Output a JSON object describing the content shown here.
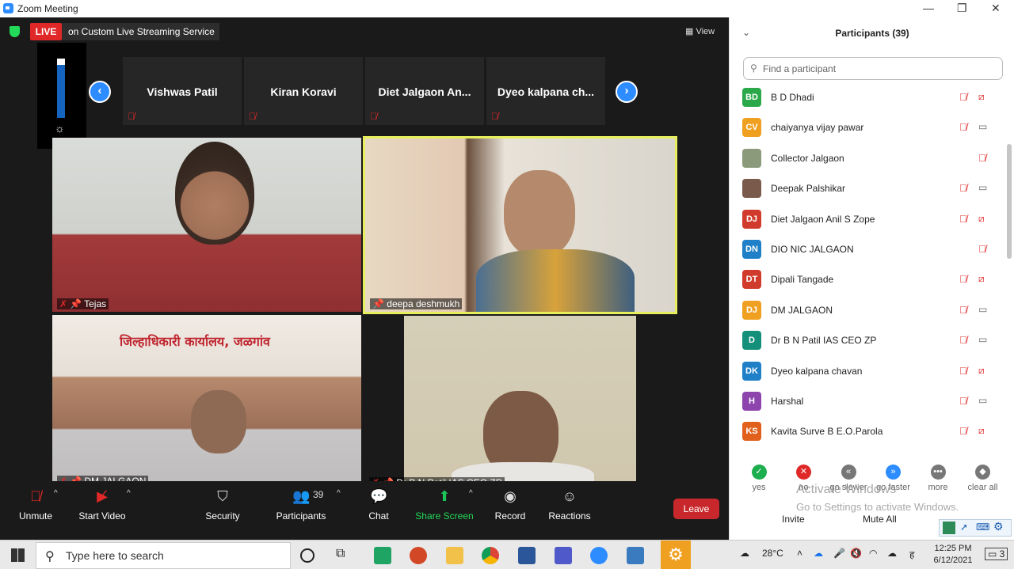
{
  "window": {
    "title": "Zoom Meeting"
  },
  "live": {
    "badge": "LIVE",
    "service": "on Custom Live Streaming Service",
    "dropdown": "▾"
  },
  "view": {
    "label": "View"
  },
  "strip": {
    "tiles": [
      "Vishwas Patil",
      "Kiran Koravi",
      "Diet Jalgaon An...",
      "Dyeo kalpana ch..."
    ]
  },
  "videos": [
    {
      "name": "Tejas"
    },
    {
      "name": "deepa deshmukh"
    },
    {
      "name": "DM JALGAON",
      "sign": "जिल्हाधिकारी कार्यालय, जळगांव"
    },
    {
      "name": "Dr B N Patil IAS CEO ZP"
    }
  ],
  "toolbar": {
    "unmute": "Unmute",
    "start_video": "Start Video",
    "security": "Security",
    "participants": "Participants",
    "participants_count": "39",
    "chat": "Chat",
    "share_screen": "Share Screen",
    "record": "Record",
    "reactions": "Reactions",
    "leave": "Leave"
  },
  "panel": {
    "title": "Participants (39)",
    "search_placeholder": "Find a participant",
    "participants": [
      {
        "initials": "BD",
        "name": "B D Dhadi",
        "color": "#2aa84a",
        "video": "off"
      },
      {
        "initials": "CV",
        "name": "chaiyanya vijay pawar",
        "color": "#f0a020",
        "video": "on"
      },
      {
        "initials": "",
        "name": "Collector Jalgaon",
        "color": "#8a9a7a",
        "video": "none"
      },
      {
        "initials": "",
        "name": "Deepak Palshikar",
        "color": "#7a5a4a",
        "video": "on"
      },
      {
        "initials": "DJ",
        "name": "Diet Jalgaon Anil S Zope",
        "color": "#d13b2c",
        "video": "off"
      },
      {
        "initials": "DN",
        "name": "DIO NIC JALGAON",
        "color": "#1f7fc7",
        "video": "none"
      },
      {
        "initials": "DT",
        "name": "Dipali Tangade",
        "color": "#d13b2c",
        "video": "off"
      },
      {
        "initials": "DJ",
        "name": "DM JALGAON",
        "color": "#f0a020",
        "video": "on"
      },
      {
        "initials": "D",
        "name": "Dr B N Patil IAS CEO ZP",
        "color": "#14907a",
        "video": "on"
      },
      {
        "initials": "DK",
        "name": "Dyeo kalpana chavan",
        "color": "#1f7fc7",
        "video": "off"
      },
      {
        "initials": "H",
        "name": "Harshal",
        "color": "#8e44ad",
        "video": "on"
      },
      {
        "initials": "KS",
        "name": "Kavita Surve B E.O.Parola",
        "color": "#e0601c",
        "video": "off"
      }
    ],
    "reactions": [
      {
        "label": "yes",
        "color": "#1cae4f",
        "glyph": "✓"
      },
      {
        "label": "no",
        "color": "#e02828",
        "glyph": "✕"
      },
      {
        "label": "go slower",
        "color": "#777777",
        "glyph": "«"
      },
      {
        "label": "go faster",
        "color": "#2d8cff",
        "glyph": "»"
      },
      {
        "label": "more",
        "color": "#777777",
        "glyph": "•••"
      },
      {
        "label": "clear all",
        "color": "#777777",
        "glyph": "◆"
      }
    ],
    "invite": "Invite",
    "mute_all": "Mute All"
  },
  "watermark": {
    "line1": "Activate Windows",
    "line2": "Go to Settings to activate Windows."
  },
  "taskbar": {
    "search_placeholder": "Type here to search",
    "temperature": "28°C",
    "lang": "ह",
    "time": "12:25 PM",
    "date": "6/12/2021",
    "notifications": "3"
  }
}
